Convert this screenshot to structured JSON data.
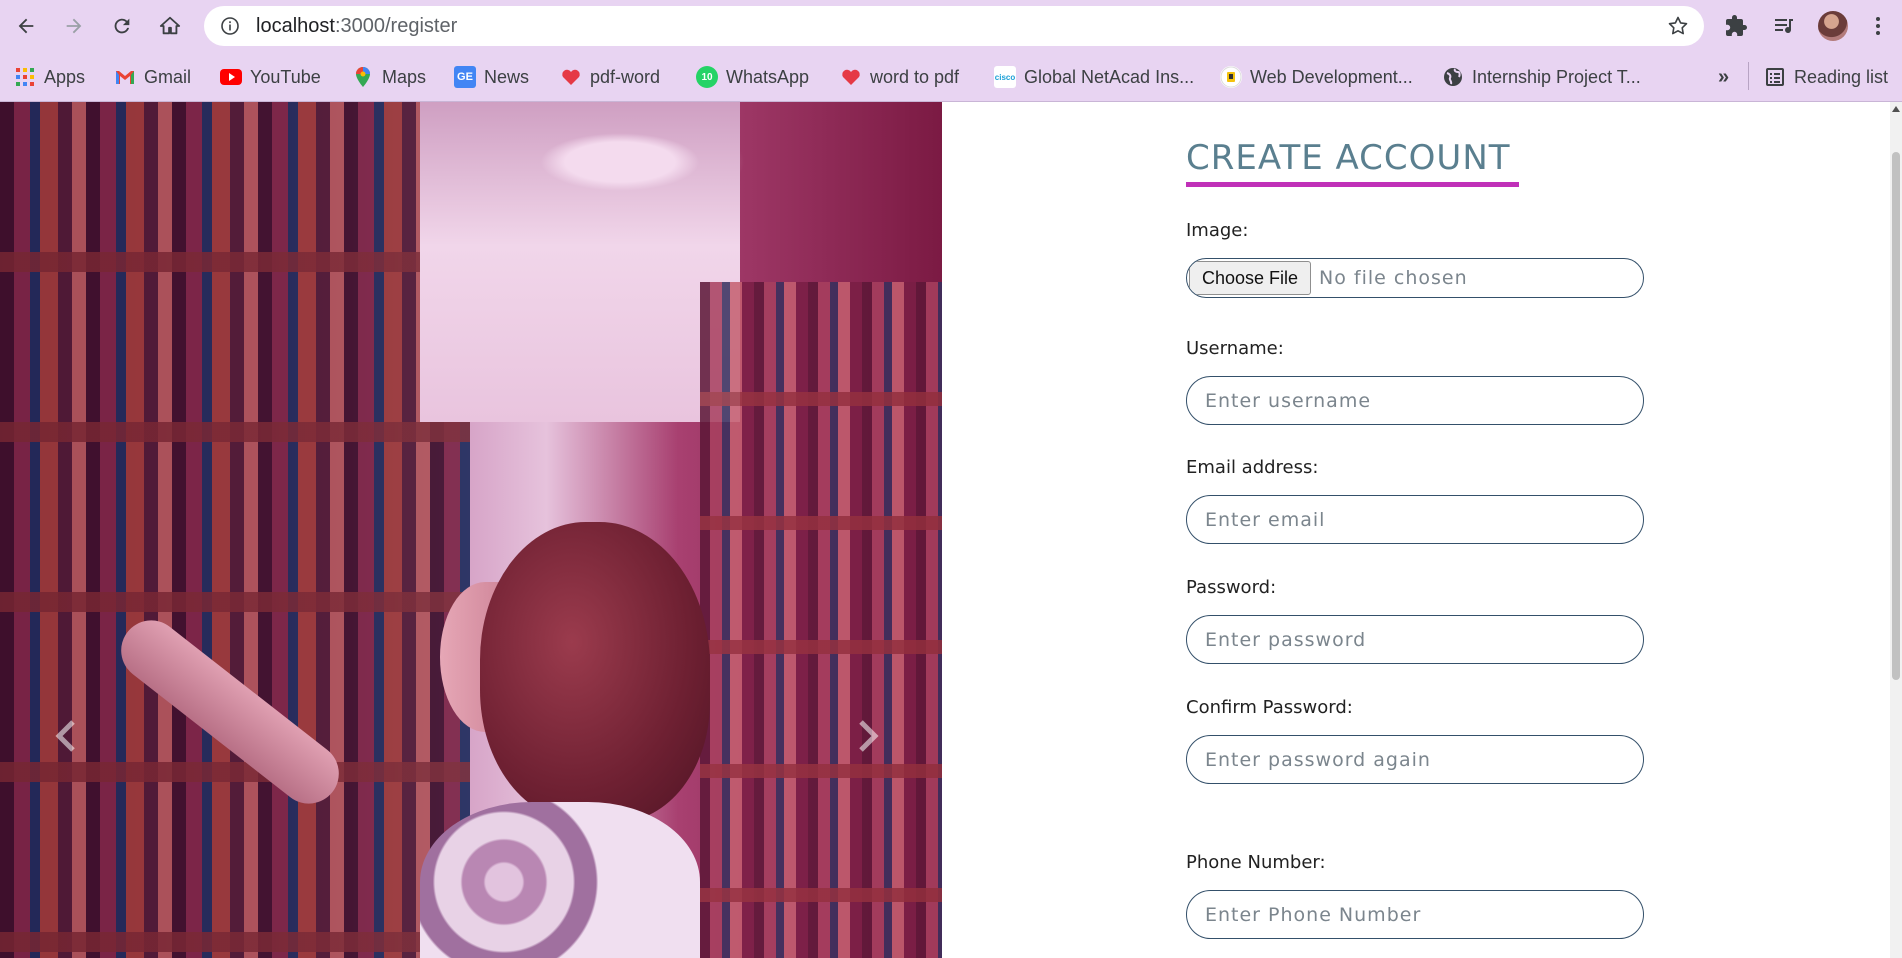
{
  "browser": {
    "url_host": "localhost",
    "url_path": ":3000/register",
    "icons": [
      "back-icon",
      "forward-icon",
      "reload-icon",
      "home-icon",
      "info-icon",
      "star-icon",
      "extensions-icon",
      "media-control-icon",
      "menu-dots-icon"
    ]
  },
  "bookmarks": [
    {
      "label": "Apps",
      "icon": "apps-icon"
    },
    {
      "label": "Gmail",
      "icon": "gmail-icon"
    },
    {
      "label": "YouTube",
      "icon": "youtube-icon"
    },
    {
      "label": "Maps",
      "icon": "maps-icon"
    },
    {
      "label": "News",
      "icon": "news-icon"
    },
    {
      "label": "pdf-word",
      "icon": "heart-icon"
    },
    {
      "label": "WhatsApp",
      "icon": "whatsapp-icon"
    },
    {
      "label": "word to pdf",
      "icon": "heart-icon"
    },
    {
      "label": "Global NetAcad Ins...",
      "icon": "cisco-icon"
    },
    {
      "label": "Web Development...",
      "icon": "webdev-icon"
    },
    {
      "label": "Internship Project T...",
      "icon": "globe-icon"
    }
  ],
  "bookmarks_overflow": "»",
  "reading_list": "Reading list",
  "whatsapp_badge": "10",
  "news_badge": "GE",
  "cisco_badge": "cisco",
  "form": {
    "title": "CREATE ACCOUNT",
    "image_label": "Image:",
    "file_button": "Choose File",
    "file_status": "No file chosen",
    "username_label": "Username:",
    "username_placeholder": "Enter username",
    "email_label": "Email address:",
    "email_placeholder": "Enter email",
    "password_label": "Password:",
    "password_placeholder": "Enter password",
    "confirm_label": "Confirm Password:",
    "confirm_placeholder": "Enter password again",
    "phone_label": "Phone Number:",
    "phone_placeholder": "Enter Phone Number"
  },
  "colors": {
    "chrome_bg": "#e8d4f2",
    "title": "#5a7f8f",
    "title_underline": "#c030b8",
    "field_border": "#34506a"
  }
}
